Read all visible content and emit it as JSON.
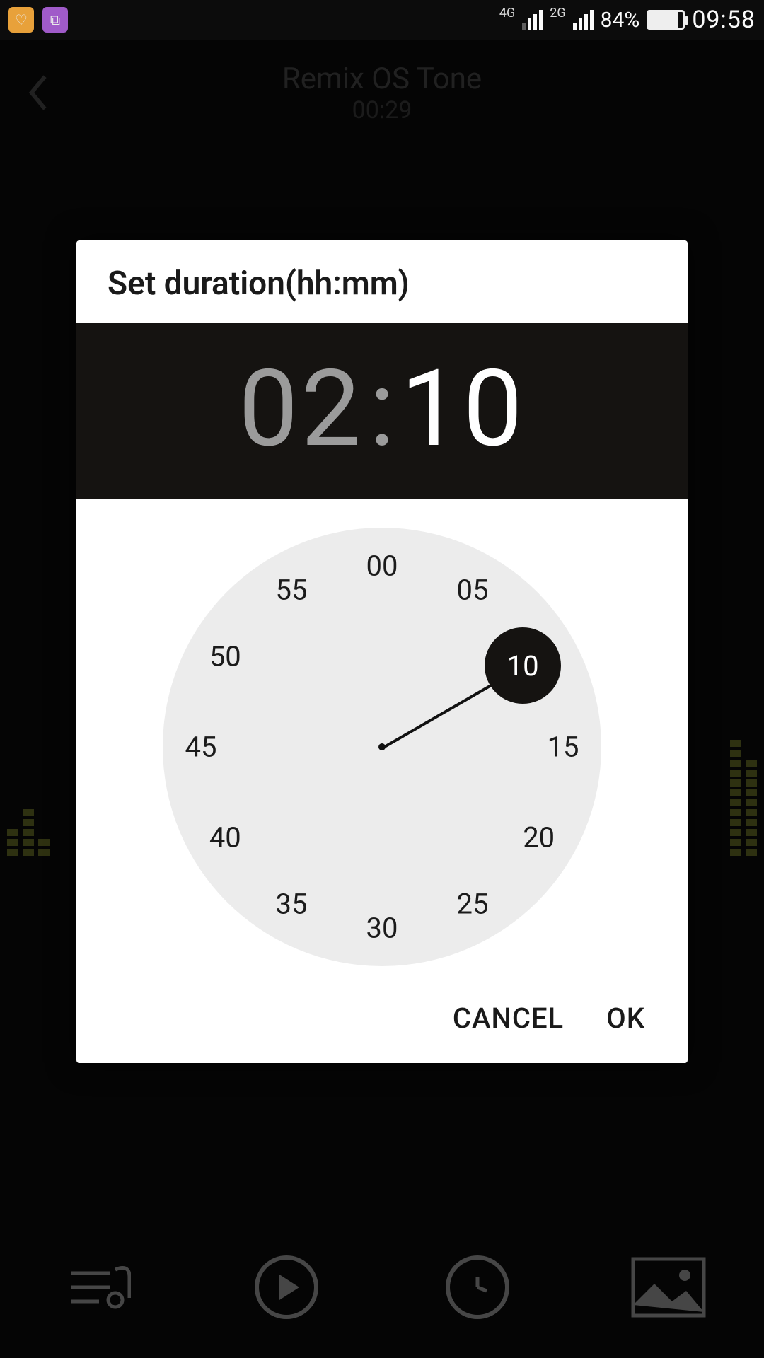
{
  "status": {
    "net1_label": "4G",
    "net2_label": "2G",
    "battery_percent": "84%",
    "battery_fill_pct": 84,
    "time": "09:58"
  },
  "header": {
    "title": "Remix OS Tone",
    "subtitle": "00:29"
  },
  "dialog": {
    "title": "Set duration(hh:mm)",
    "hours": "02",
    "minutes": "10",
    "selected_minute": 10,
    "ticks": [
      "00",
      "05",
      "10",
      "15",
      "20",
      "25",
      "30",
      "35",
      "40",
      "45",
      "50",
      "55"
    ],
    "cancel": "CANCEL",
    "ok": "OK"
  }
}
